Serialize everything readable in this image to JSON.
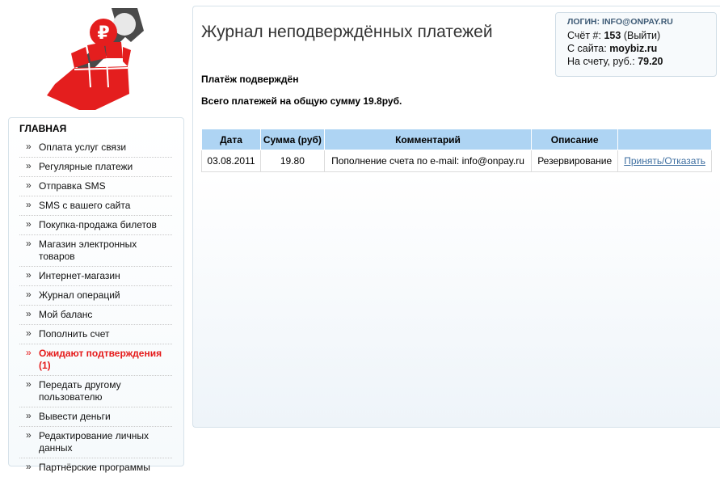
{
  "sidebar": {
    "title": "ГЛАВНАЯ",
    "items": [
      {
        "label": "Оплата услуг связи",
        "active": false
      },
      {
        "label": "Регулярные платежи",
        "active": false
      },
      {
        "label": "Отправка SMS",
        "active": false
      },
      {
        "label": "SMS с вашего сайта",
        "active": false
      },
      {
        "label": "Покупка-продажа билетов",
        "active": false
      },
      {
        "label": "Магазин электронных товаров",
        "active": false
      },
      {
        "label": "Интернет-магазин",
        "active": false
      },
      {
        "label": "Журнал операций",
        "active": false
      },
      {
        "label": "Мой баланс",
        "active": false
      },
      {
        "label": "Пополнить счет",
        "active": false
      },
      {
        "label": "Ожидают подтверждения (1)",
        "active": true
      },
      {
        "label": "Передать другому пользователю",
        "active": false
      },
      {
        "label": "Вывести деньги",
        "active": false
      },
      {
        "label": "Редактирование личных данных",
        "active": false
      },
      {
        "label": "Партнёрские программы",
        "active": false
      }
    ],
    "bullet": "»"
  },
  "page": {
    "title": "Журнал неподверждённых платежей",
    "status": "Платёж подверждён",
    "summary": "Всего платежей на общую сумму 19.8руб."
  },
  "login": {
    "label": "ЛОГИН: INFO@ONPAY.RU",
    "account_prefix": "Счёт #:",
    "account_number": "153",
    "logout": "(Выйти)",
    "site_prefix": "С сайта:",
    "site": "moybiz.ru",
    "balance_prefix": "На счету, руб.:",
    "balance": "79.20"
  },
  "table": {
    "headers": [
      "Дата",
      "Сумма (руб)",
      "Комментарий",
      "Описание",
      ""
    ],
    "rows": [
      {
        "date": "03.08.2011",
        "amount": "19.80",
        "comment": "Пополнение счета по e-mail: info@onpay.ru",
        "description": "Резервирование",
        "action": "Принять/Отказать"
      }
    ]
  },
  "colors": {
    "accent_red": "#e51a1a",
    "header_blue": "#aed4f3",
    "link": "#3d6ea0"
  }
}
